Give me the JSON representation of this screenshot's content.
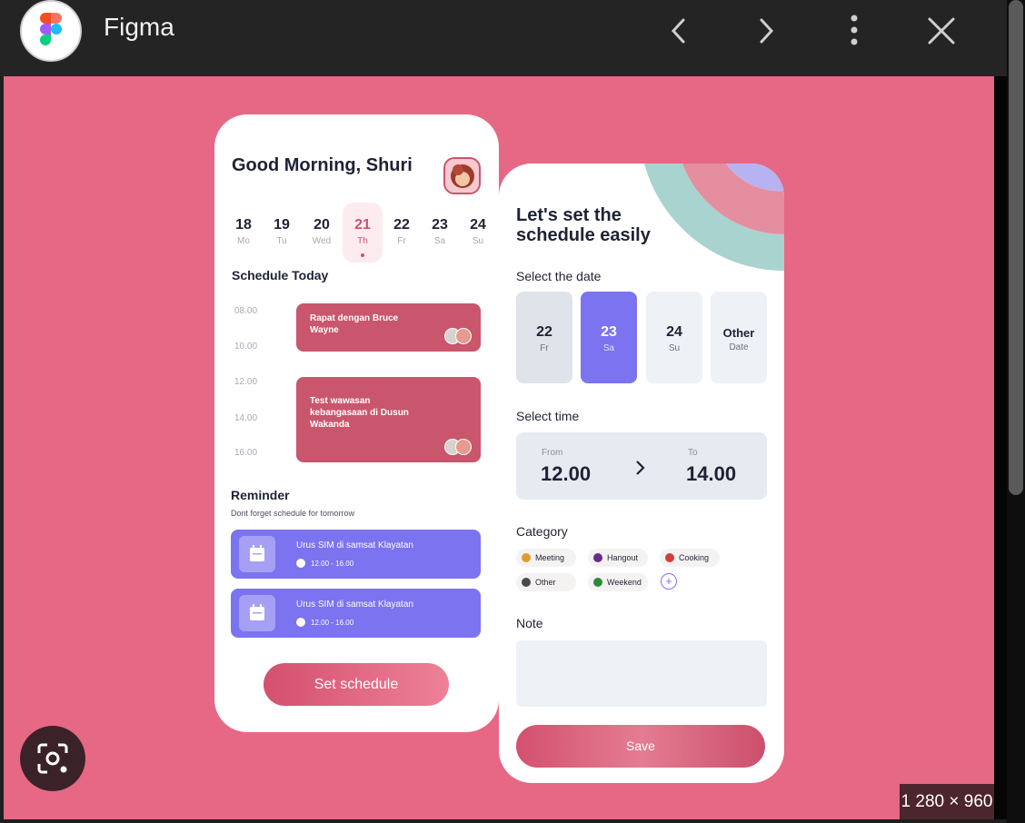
{
  "header": {
    "app_title": "Figma",
    "back_icon": "chevron-left-icon",
    "forward_icon": "chevron-right-icon",
    "menu_icon": "more-vertical-icon",
    "close_icon": "close-icon"
  },
  "colors": {
    "background": "#e66884",
    "primary_pink": "#c9566c",
    "primary_purple": "#7c73f0"
  },
  "phone1": {
    "greeting": "Good Morning, Shuri",
    "days": [
      {
        "num": "18",
        "label": "Mo"
      },
      {
        "num": "19",
        "label": "Tu"
      },
      {
        "num": "20",
        "label": "Wed"
      },
      {
        "num": "21",
        "label": "Th",
        "active": true
      },
      {
        "num": "22",
        "label": "Fr"
      },
      {
        "num": "23",
        "label": "Sa"
      },
      {
        "num": "24",
        "label": "Su"
      }
    ],
    "schedule_title": "Schedule Today",
    "times": [
      "08.00",
      "10.00",
      "12.00",
      "14.00",
      "16.00"
    ],
    "events": [
      {
        "title": "Rapat dengan Bruce Wayne"
      },
      {
        "title": "Test wawasan kebangasaan di Dusun Wakanda"
      }
    ],
    "reminder_title": "Reminder",
    "reminder_sub": "Dont forget schedule for tomorrow",
    "reminders": [
      {
        "title": "Urus SIM di samsat Klayatan",
        "time": "12.00 - 16.00"
      },
      {
        "title": "Urus SIM di samsat Klayatan",
        "time": "12.00 - 16.00"
      }
    ],
    "set_schedule": "Set schedule"
  },
  "phone2": {
    "heading": "Let's set the schedule easily",
    "select_date_label": "Select the date",
    "dates": [
      {
        "num": "22",
        "label": "Fr"
      },
      {
        "num": "23",
        "label": "Sa",
        "selected": true
      },
      {
        "num": "24",
        "label": "Su"
      },
      {
        "num": "Other",
        "label": "Date"
      }
    ],
    "select_time_label": "Select time",
    "time_from_label": "From",
    "time_from": "12.00",
    "time_to_label": "To",
    "time_to": "14.00",
    "category_label": "Category",
    "categories": [
      {
        "name": "Meeting",
        "color": "#e09a2e"
      },
      {
        "name": "Hangout",
        "color": "#6b2a86"
      },
      {
        "name": "Cooking",
        "color": "#d63b3b"
      },
      {
        "name": "Other",
        "color": "#4a4a4a"
      },
      {
        "name": "Weekend",
        "color": "#2e8a3a"
      }
    ],
    "note_label": "Note",
    "save": "Save"
  },
  "overlay": {
    "image_size": "1 280 × 960"
  }
}
